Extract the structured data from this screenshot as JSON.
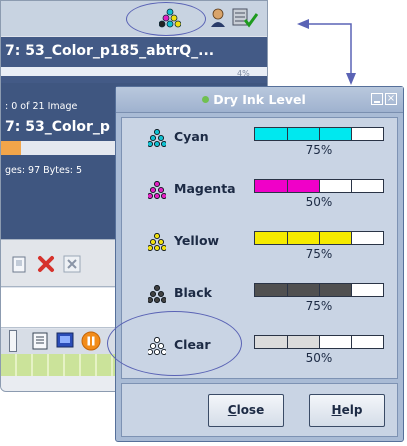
{
  "background_app": {
    "job1_title": "7: 53_Color_p185_abtrQ_...",
    "job1_percent": "4%",
    "job2_meta": ": 0 of 21   Image",
    "job2_title": "7: 53_Color_p",
    "job2_pages": "ges: 97   Bytes: 5"
  },
  "dialog": {
    "title": "Dry Ink Level",
    "close_button": "Close",
    "close_mnemonic": "C",
    "close_rest": "lose",
    "help_button": "Help",
    "help_mnemonic": "H",
    "help_rest": "elp",
    "inks": [
      {
        "name": "Cyan",
        "level": 0.75,
        "percent_label": "75%",
        "color": "#00e8ef",
        "icon": "cmyk-dots-icon"
      },
      {
        "name": "Magenta",
        "level": 0.5,
        "percent_label": "50%",
        "color": "#f000c8",
        "icon": "magenta-dots-icon"
      },
      {
        "name": "Yellow",
        "level": 0.75,
        "percent_label": "75%",
        "color": "#f5ea00",
        "icon": "yellow-dots-icon"
      },
      {
        "name": "Black",
        "level": 0.75,
        "percent_label": "75%",
        "color": "#505050",
        "icon": "black-dots-icon"
      },
      {
        "name": "Clear",
        "level": 0.5,
        "percent_label": "50%",
        "color": "#dcdcdc",
        "icon": "clear-dots-icon"
      }
    ]
  },
  "colors": {
    "accent_blue": "#3f5680",
    "dialog_frame": "#a9bbd5",
    "annotation_blue": "#5a63b5"
  }
}
